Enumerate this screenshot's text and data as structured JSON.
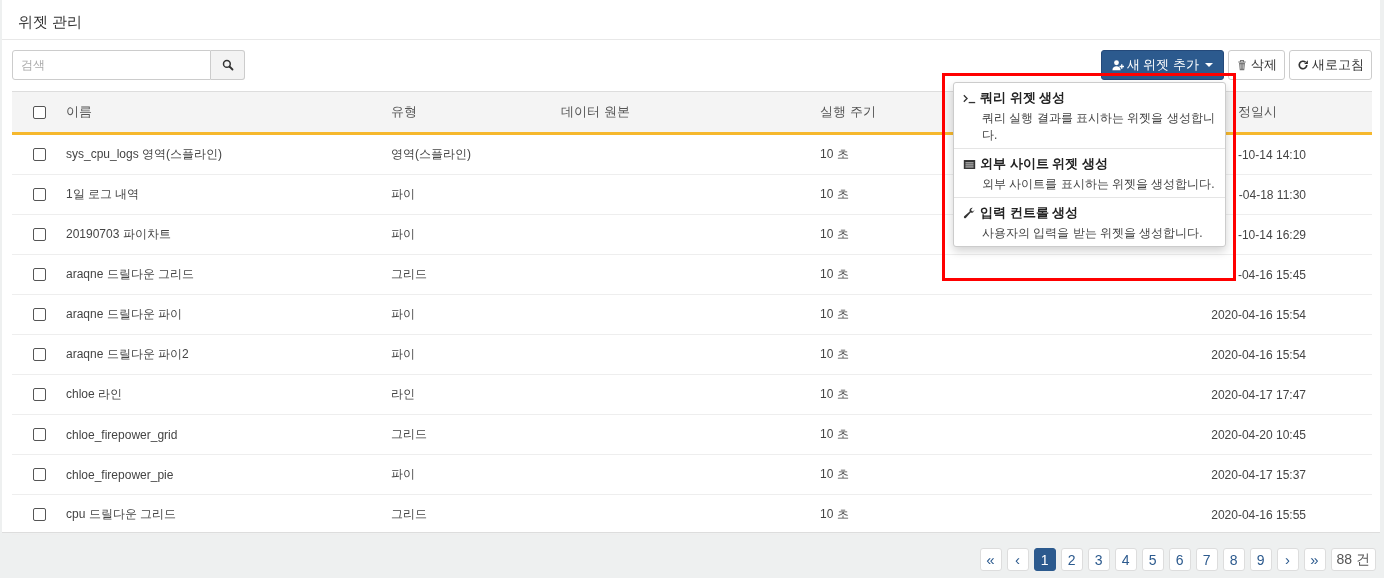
{
  "panel": {
    "title": "위젯 관리"
  },
  "search": {
    "placeholder": "검색"
  },
  "toolbar": {
    "buttons": [
      {
        "kind": "add",
        "label": "새 위젯 추가"
      },
      {
        "kind": "delete",
        "label": "삭제"
      },
      {
        "kind": "refresh",
        "label": "새로고침"
      }
    ]
  },
  "table": {
    "select_all": {
      "checked": false
    },
    "columns": [
      "이름",
      "유형",
      "데이터 원본",
      "실행 주기",
      "",
      "정일시"
    ],
    "rows": [
      {
        "checked": false,
        "name": "sys_cpu_logs 영역(스플라인)",
        "type": "영역(스플라인)",
        "interval": "10 초",
        "modified": "-10-14 14:10"
      },
      {
        "checked": false,
        "name": "1일 로그 내역",
        "type": "파이",
        "interval": "10 초",
        "modified": "-04-18 11:30"
      },
      {
        "checked": false,
        "name": "20190703 파이차트",
        "type": "파이",
        "interval": "10 초",
        "modified": "-10-14 16:29"
      },
      {
        "checked": false,
        "name": "araqne 드릴다운 그리드",
        "type": "그리드",
        "interval": "10 초",
        "modified": "-04-16 15:45"
      },
      {
        "checked": false,
        "name": "araqne 드릴다운 파이",
        "type": "파이",
        "interval": "10 초",
        "modified": "2020-04-16 15:54"
      },
      {
        "checked": false,
        "name": "araqne 드릴다운 파이2",
        "type": "파이",
        "interval": "10 초",
        "modified": "2020-04-16 15:54"
      },
      {
        "checked": false,
        "name": "chloe 라인",
        "type": "라인",
        "interval": "10 초",
        "modified": "2020-04-17 17:47"
      },
      {
        "checked": false,
        "name": "chloe_firepower_grid",
        "type": "그리드",
        "interval": "10 초",
        "modified": "2020-04-20 10:45"
      },
      {
        "checked": false,
        "name": "chloe_firepower_pie",
        "type": "파이",
        "interval": "10 초",
        "modified": "2020-04-17 15:37"
      },
      {
        "checked": false,
        "name": "cpu 드릴다운 그리드",
        "type": "그리드",
        "interval": "10 초",
        "modified": "2020-04-16 15:55"
      }
    ]
  },
  "dropdown": {
    "items": [
      {
        "kind": "query",
        "title": "쿼리 위젯 생성",
        "description": "쿼리 실행 결과를 표시하는 위젯을 생성합니다."
      },
      {
        "kind": "site",
        "title": "외부 사이트 위젯 생성",
        "description": "외부 사이트를 표시하는 위젯을 생성합니다."
      },
      {
        "kind": "input",
        "title": "입력 컨트롤 생성",
        "description": "사용자의 입력을 받는 위젯을 생성합니다."
      }
    ]
  },
  "pagination": {
    "pages": [
      {
        "kind": "first",
        "label": "«",
        "selected": false
      },
      {
        "kind": "prev",
        "label": "‹",
        "selected": false
      },
      {
        "kind": "page",
        "label": "1",
        "selected": true
      },
      {
        "kind": "page",
        "label": "2",
        "selected": false
      },
      {
        "kind": "page",
        "label": "3",
        "selected": false
      },
      {
        "kind": "page",
        "label": "4",
        "selected": false
      },
      {
        "kind": "page",
        "label": "5",
        "selected": false
      },
      {
        "kind": "page",
        "label": "6",
        "selected": false
      },
      {
        "kind": "page",
        "label": "7",
        "selected": false
      },
      {
        "kind": "page",
        "label": "8",
        "selected": false
      },
      {
        "kind": "page",
        "label": "9",
        "selected": false
      },
      {
        "kind": "next",
        "label": "›",
        "selected": false
      },
      {
        "kind": "last",
        "label": "»",
        "selected": false
      }
    ],
    "total": "88 건"
  }
}
